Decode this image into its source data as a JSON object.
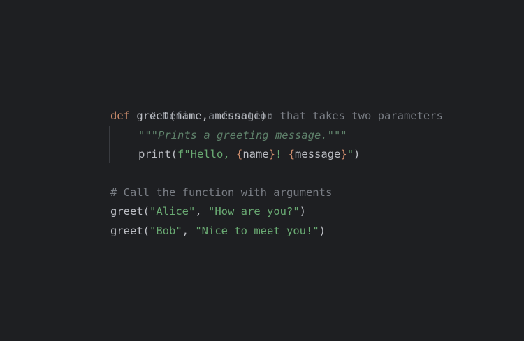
{
  "colors": {
    "background": "#1e1f22",
    "text": "#bcbec4",
    "comment": "#7a7e85",
    "keyword": "#cf8e6d",
    "string": "#6aab73",
    "docstring": "#5f826b"
  },
  "code": {
    "comment1": "# Define a function that takes two parameters",
    "def_keyword": "def",
    "def_sig": " greet(name, message):",
    "docstring": "\"\"\"Prints a greeting message.\"\"\"",
    "print_call": "print(",
    "fstring_prefix": "f\"Hello, ",
    "brace_open1": "{",
    "var_name": "name",
    "brace_close1": "}",
    "fstring_mid": "! ",
    "brace_open2": "{",
    "var_message": "message",
    "brace_close2": "}",
    "fstring_end": "\"",
    "print_close": ")",
    "comment2": "# Call the function with arguments",
    "call1_open": "greet(",
    "call1_arg1": "\"Alice\"",
    "call1_sep": ", ",
    "call1_arg2": "\"How are you?\"",
    "call1_close": ")",
    "call2_open": "greet(",
    "call2_arg1": "\"Bob\"",
    "call2_sep": ", ",
    "call2_arg2": "\"Nice to meet you!\"",
    "call2_close": ")"
  }
}
